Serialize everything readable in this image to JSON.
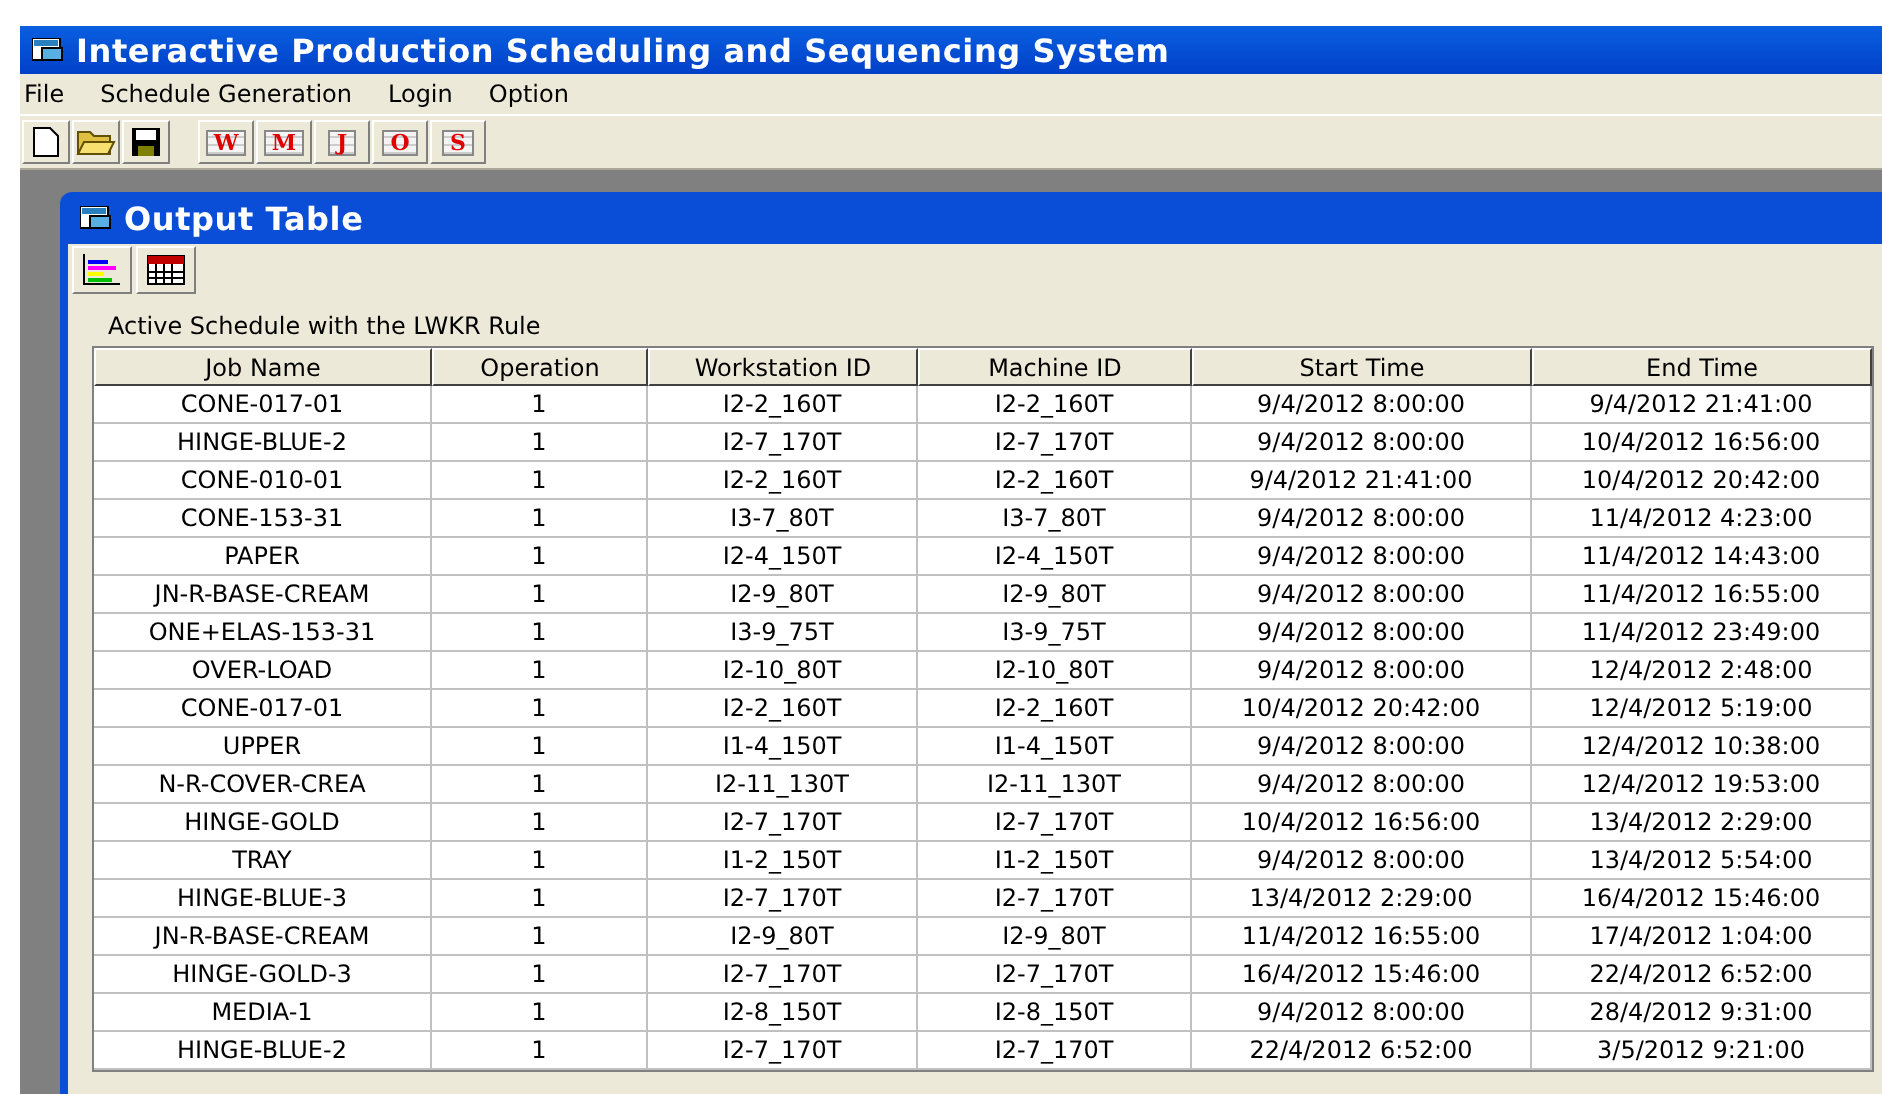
{
  "window": {
    "title": "Interactive Production Scheduling and Sequencing System"
  },
  "menu": [
    "File",
    "Schedule Generation",
    "Login",
    "Option"
  ],
  "toolbar": [
    {
      "kind": "new"
    },
    {
      "kind": "open"
    },
    {
      "kind": "save"
    },
    {
      "kind": "letter",
      "label": "W"
    },
    {
      "kind": "letter",
      "label": "M"
    },
    {
      "kind": "letter",
      "label": "J"
    },
    {
      "kind": "letter",
      "label": "O"
    },
    {
      "kind": "letter",
      "label": "S"
    }
  ],
  "child": {
    "title": "Output Table",
    "tools": [
      {
        "kind": "gantt"
      },
      {
        "kind": "table"
      }
    ],
    "caption": "Active Schedule with the LWKR Rule"
  },
  "table": {
    "columns": [
      "Job Name",
      "Operation",
      "Workstation ID",
      "Machine ID",
      "Start Time",
      "End Time"
    ],
    "rows": [
      [
        "CONE-017-01",
        "1",
        "I2-2_160T",
        "I2-2_160T",
        "9/4/2012 8:00:00",
        "9/4/2012 21:41:00"
      ],
      [
        "HINGE-BLUE-2",
        "1",
        "I2-7_170T",
        "I2-7_170T",
        "9/4/2012 8:00:00",
        "10/4/2012 16:56:00"
      ],
      [
        "CONE-010-01",
        "1",
        "I2-2_160T",
        "I2-2_160T",
        "9/4/2012 21:41:00",
        "10/4/2012 20:42:00"
      ],
      [
        "CONE-153-31",
        "1",
        "I3-7_80T",
        "I3-7_80T",
        "9/4/2012 8:00:00",
        "11/4/2012 4:23:00"
      ],
      [
        "PAPER",
        "1",
        "I2-4_150T",
        "I2-4_150T",
        "9/4/2012 8:00:00",
        "11/4/2012 14:43:00"
      ],
      [
        "JN-R-BASE-CREAM",
        "1",
        "I2-9_80T",
        "I2-9_80T",
        "9/4/2012 8:00:00",
        "11/4/2012 16:55:00"
      ],
      [
        "ONE+ELAS-153-31",
        "1",
        "I3-9_75T",
        "I3-9_75T",
        "9/4/2012 8:00:00",
        "11/4/2012 23:49:00"
      ],
      [
        "OVER-LOAD",
        "1",
        "I2-10_80T",
        "I2-10_80T",
        "9/4/2012 8:00:00",
        "12/4/2012 2:48:00"
      ],
      [
        "CONE-017-01",
        "1",
        "I2-2_160T",
        "I2-2_160T",
        "10/4/2012 20:42:00",
        "12/4/2012 5:19:00"
      ],
      [
        "UPPER",
        "1",
        "I1-4_150T",
        "I1-4_150T",
        "9/4/2012 8:00:00",
        "12/4/2012 10:38:00"
      ],
      [
        "N-R-COVER-CREA",
        "1",
        "I2-11_130T",
        "I2-11_130T",
        "9/4/2012 8:00:00",
        "12/4/2012 19:53:00"
      ],
      [
        "HINGE-GOLD",
        "1",
        "I2-7_170T",
        "I2-7_170T",
        "10/4/2012 16:56:00",
        "13/4/2012 2:29:00"
      ],
      [
        "TRAY",
        "1",
        "I1-2_150T",
        "I1-2_150T",
        "9/4/2012 8:00:00",
        "13/4/2012 5:54:00"
      ],
      [
        "HINGE-BLUE-3",
        "1",
        "I2-7_170T",
        "I2-7_170T",
        "13/4/2012 2:29:00",
        "16/4/2012 15:46:00"
      ],
      [
        "JN-R-BASE-CREAM",
        "1",
        "I2-9_80T",
        "I2-9_80T",
        "11/4/2012 16:55:00",
        "17/4/2012 1:04:00"
      ],
      [
        "HINGE-GOLD-3",
        "1",
        "I2-7_170T",
        "I2-7_170T",
        "16/4/2012 15:46:00",
        "22/4/2012 6:52:00"
      ],
      [
        "MEDIA-1",
        "1",
        "I2-8_150T",
        "I2-8_150T",
        "9/4/2012 8:00:00",
        "28/4/2012 9:31:00"
      ],
      [
        "HINGE-BLUE-2",
        "1",
        "I2-7_170T",
        "I2-7_170T",
        "22/4/2012 6:52:00",
        "3/5/2012 9:21:00"
      ]
    ]
  }
}
